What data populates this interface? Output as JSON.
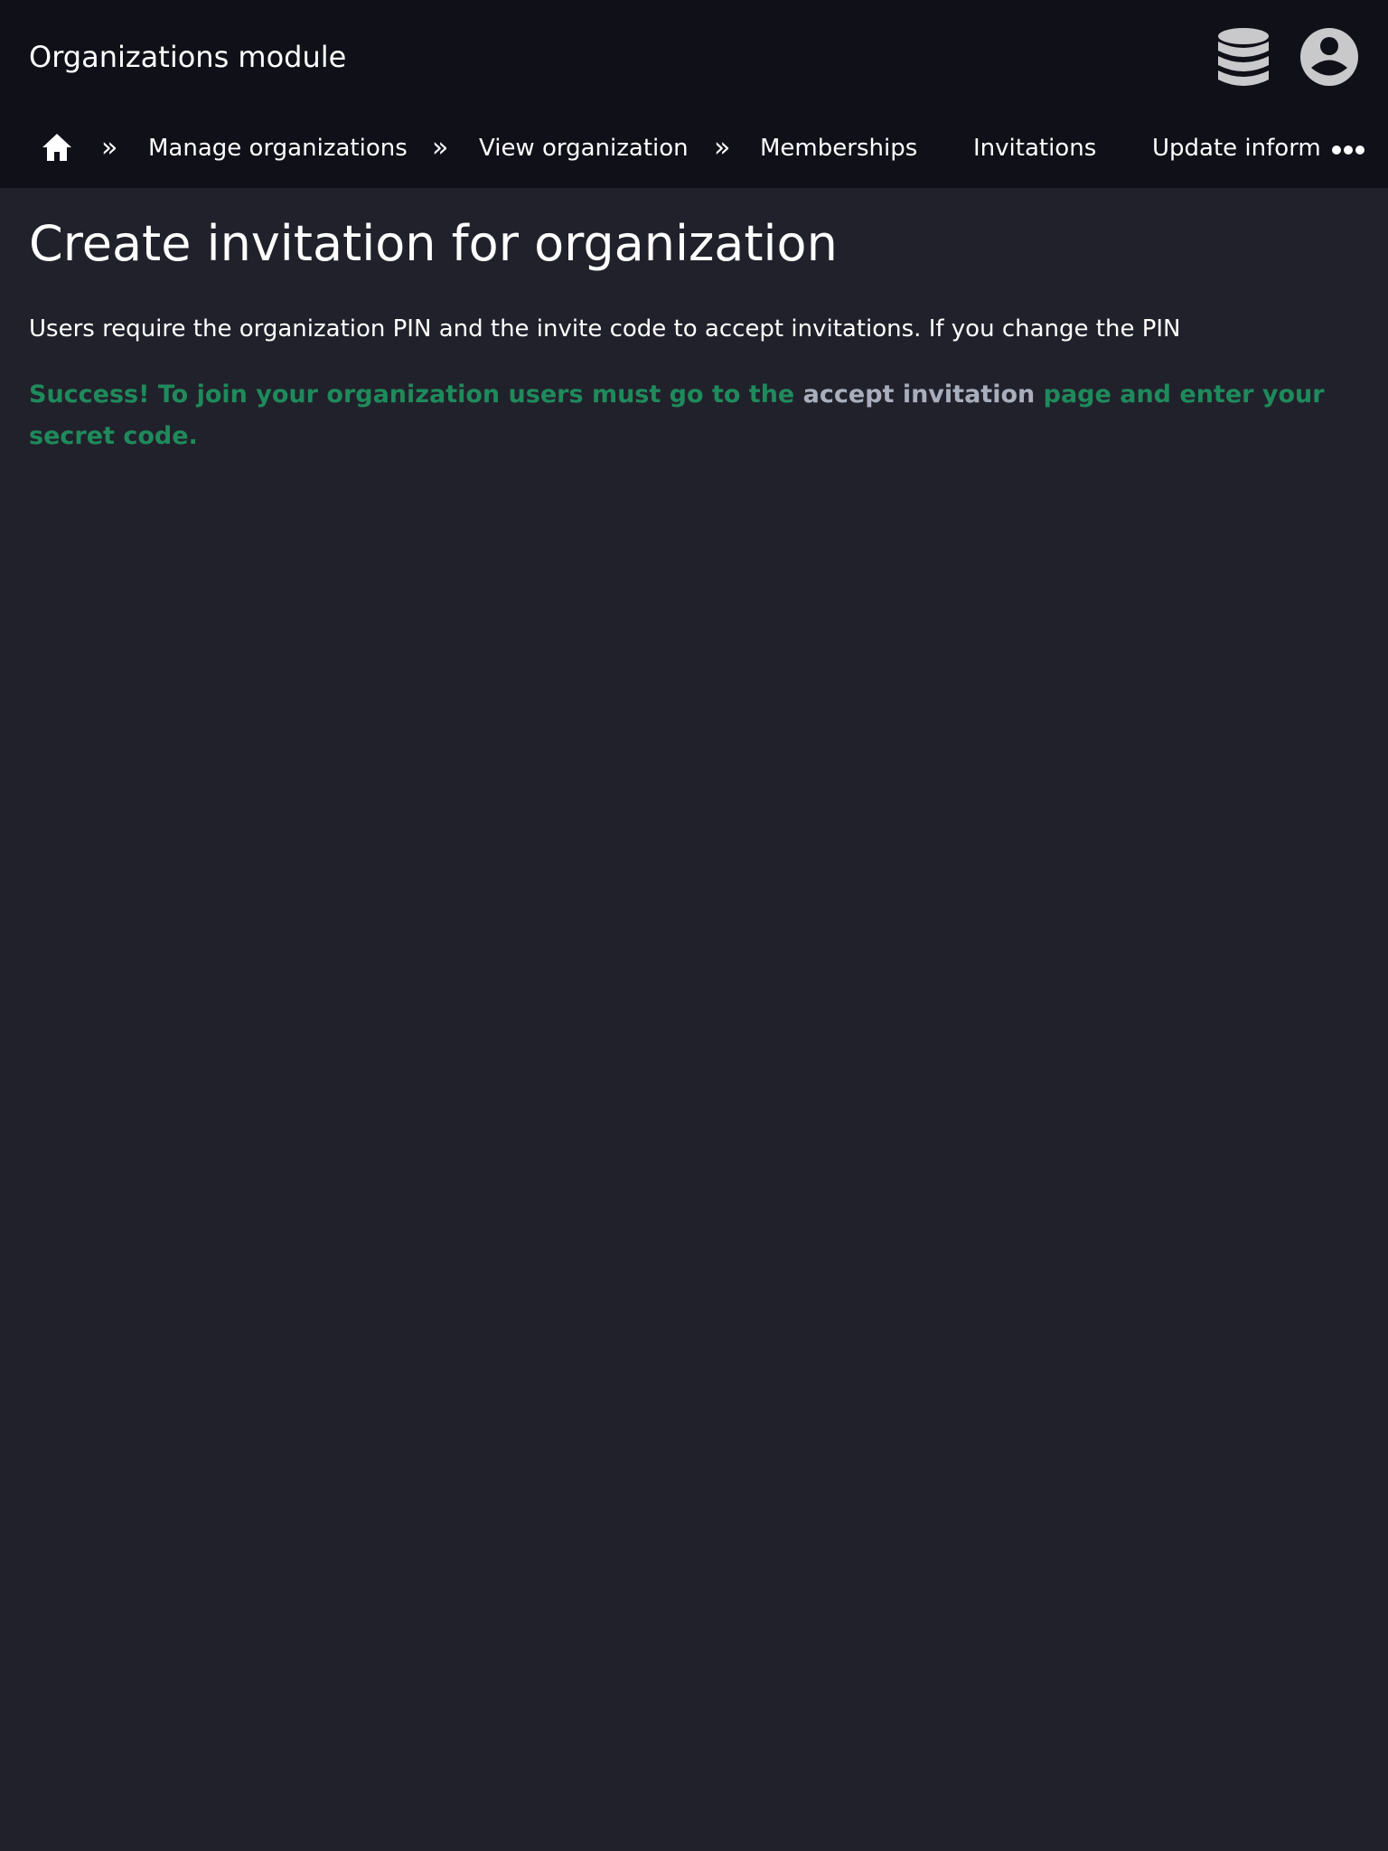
{
  "header": {
    "title": "Organizations module",
    "icons": {
      "database": "database-icon",
      "user": "user-circle-icon"
    }
  },
  "breadcrumb": {
    "home_icon": "home-icon",
    "separator": "»",
    "items": [
      {
        "label": "Manage organizations"
      },
      {
        "label": "View organization"
      }
    ],
    "tabs": [
      {
        "label": "Memberships"
      },
      {
        "label": "Invitations"
      },
      {
        "label": "Update inform"
      }
    ],
    "more_icon": "more-dots-icon"
  },
  "main": {
    "title": "Create invitation for organization",
    "description": "Users require the organization PIN and the invite code to accept invitations. If you change the PIN",
    "success": {
      "before": "Success! To join your organization users must go to the ",
      "link": "accept invitation",
      "after": " page and enter your secret code."
    }
  },
  "colors": {
    "header_bg": "#101019",
    "page_bg": "#21212b",
    "success_green": "#1f8a5b",
    "link_gray": "#a9aebd",
    "icon_gray": "#c9c9cc"
  }
}
